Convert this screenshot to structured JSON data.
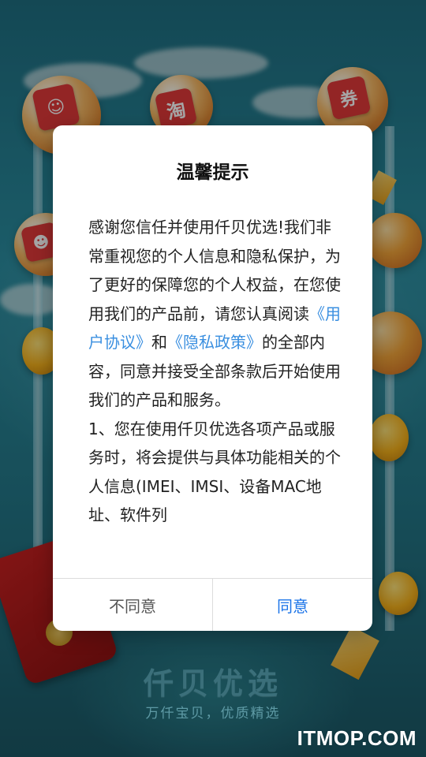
{
  "splash": {
    "brand_name": "仟贝优选",
    "slogan": "万仟宝贝，优质精选",
    "watermark": "ITMOP.COM",
    "icons": [
      "kfc-logo-icon",
      "taobao-logo-icon",
      "coupon-logo-icon",
      "smile-logo-icon"
    ]
  },
  "dialog": {
    "title": "温馨提示",
    "body": {
      "intro": "感谢您信任并使用仟贝优选!我们非常重视您的个人信息和隐私保护，为了更好的保障您的个人权益，在您使用我们的产品前，请您认真阅读",
      "user_agreement_link": "《用户协议》",
      "and": "和",
      "privacy_policy_link": "《隐私政策》",
      "rest": "的全部内容，同意并接受全部条款后开始使用我们的产品和服务。",
      "item1": "1、您在使用仟贝优选各项产品或服务时，将会提供与具体功能相关的个人信息(IMEI、IMSI、设备MAC地址、软件列"
    },
    "buttons": {
      "decline": "不同意",
      "agree": "同意"
    }
  },
  "colors": {
    "link": "#3a8fe0",
    "agree": "#1a73e8",
    "background": "#2a8ea1"
  }
}
